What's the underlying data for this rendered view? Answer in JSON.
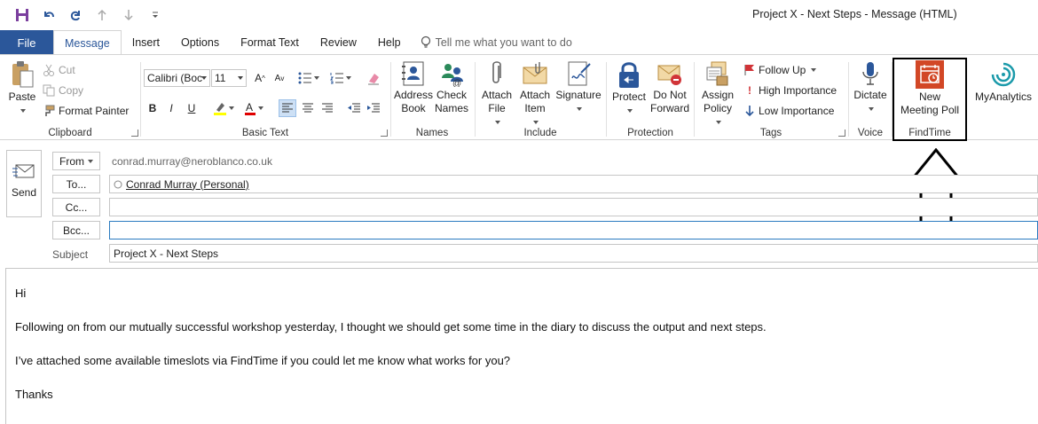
{
  "window": {
    "title": "Project X - Next Steps  -  Message (HTML)"
  },
  "tabs": [
    {
      "label": "File"
    },
    {
      "label": "Message"
    },
    {
      "label": "Insert"
    },
    {
      "label": "Options"
    },
    {
      "label": "Format Text"
    },
    {
      "label": "Review"
    },
    {
      "label": "Help"
    }
  ],
  "tell_me": "Tell me what you want to do",
  "ribbon": {
    "clipboard": {
      "label": "Clipboard",
      "paste": "Paste",
      "cut": "Cut",
      "copy": "Copy",
      "format_painter": "Format Painter"
    },
    "basic_text": {
      "label": "Basic Text",
      "font": "Calibri (Boc",
      "size": "11",
      "bold": "B",
      "italic": "I",
      "underline": "U"
    },
    "names": {
      "label": "Names",
      "address_book": "Address Book",
      "check_names": "Check Names"
    },
    "include": {
      "label": "Include",
      "attach_file": "Attach File",
      "attach_item": "Attach Item",
      "signature": "Signature"
    },
    "protection": {
      "label": "Protection",
      "protect": "Protect",
      "do_not_forward": "Do Not Forward"
    },
    "tags": {
      "label": "Tags",
      "assign_policy": "Assign Policy",
      "follow_up": "Follow Up",
      "high_importance": "High Importance",
      "low_importance": "Low Importance"
    },
    "voice": {
      "label": "Voice",
      "dictate": "Dictate"
    },
    "findtime": {
      "label": "FindTime",
      "new_meeting_poll": "New Meeting Poll"
    },
    "myanalytics": {
      "label": "MyAnalytics"
    }
  },
  "compose": {
    "send": "Send",
    "from_button": "From",
    "from_value": "conrad.murray@neroblanco.co.uk",
    "to_button": "To...",
    "to_value": "Conrad Murray (Personal)",
    "cc_button": "Cc...",
    "cc_value": "",
    "bcc_button": "Bcc...",
    "bcc_value": "",
    "subject_label": "Subject",
    "subject_value": "Project X - Next Steps"
  },
  "body": {
    "lines": [
      "Hi",
      "Following on from our mutually successful workshop yesterday, I thought we should get some time in the diary to discuss the output and next steps.",
      "I’ve attached some available timeslots via FindTime if you could let me know what works for you?",
      "Thanks"
    ]
  },
  "colors": {
    "accent": "#2b579a",
    "findtime": "#d24726",
    "protect": "#2b579a",
    "myanalytics": "#1b9aaa"
  }
}
